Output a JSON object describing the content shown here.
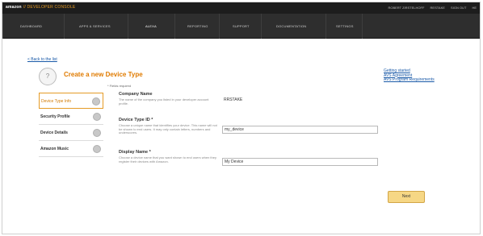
{
  "topbar": {
    "logo": "amazon",
    "logo_sub": "// DEVELOPER CONSOLE",
    "user": "ROBERT ZIRSTELHOFF",
    "account": "RESTAKE",
    "signout": "SIGN OUT",
    "help": "HE"
  },
  "nav": {
    "items": [
      {
        "label": "DASHBOARD"
      },
      {
        "label": "APPS & SERVICES"
      },
      {
        "label": "ALEXA"
      },
      {
        "label": "REPORTING"
      },
      {
        "label": "SUPPORT"
      },
      {
        "label": "DOCUMENTATION"
      },
      {
        "label": "SETTINGS"
      }
    ],
    "active_index": 2
  },
  "content": {
    "back_link": "< Back to the list",
    "help_glyph": "?",
    "title": "Create a new Device Type",
    "fields_required": "* Fields required",
    "right_links": [
      "Getting started",
      "AVS Agreement",
      "AVS Program Requirements"
    ]
  },
  "steps": [
    {
      "label": "Device Type Info",
      "active": true
    },
    {
      "label": "Security Profile",
      "active": false
    },
    {
      "label": "Device Details",
      "active": false
    },
    {
      "label": "Amazon Music",
      "active": false
    }
  ],
  "form": {
    "company": {
      "label": "Company Name",
      "help": "The name of the company you listed in your developer account profile.",
      "value": "RRSTAKE"
    },
    "device_type_id": {
      "label": "Device Type ID *",
      "help": "Choose a unique name that identifies your device. This name will not be shown to end users. It may only contain letters, numbers and underscores.",
      "value": "my_device"
    },
    "display_name": {
      "label": "Display Name *",
      "help": "Choose a device name that you want shown to end users when they register their devices with Amazon.",
      "value": "My Device"
    }
  },
  "buttons": {
    "next": "Next"
  }
}
